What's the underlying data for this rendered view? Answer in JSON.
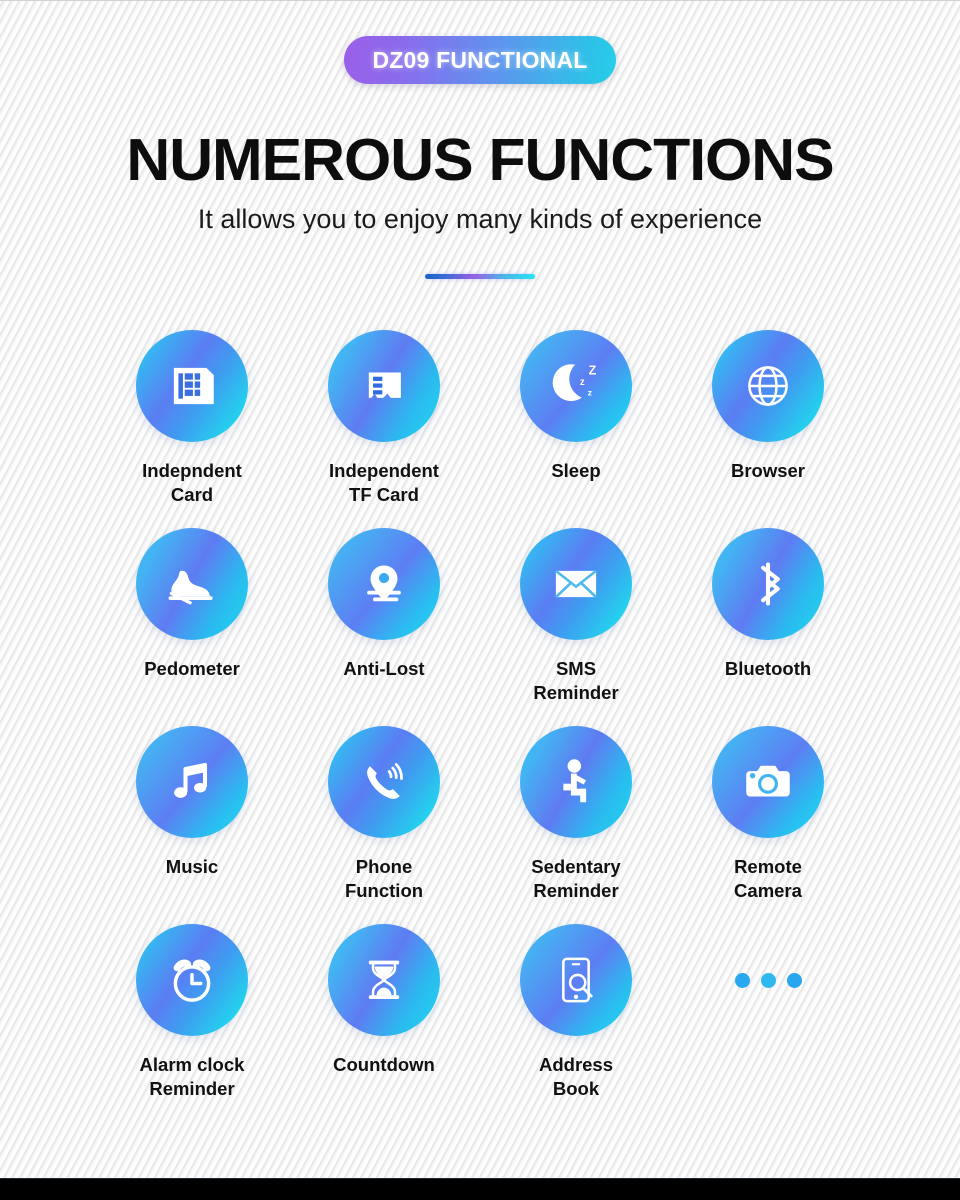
{
  "badge": {
    "label": "DZ09 FUNCTIONAL"
  },
  "header": {
    "title": "NUMEROUS FUNCTIONS",
    "subtitle": "It allows you to enjoy many kinds of experience"
  },
  "colors": {
    "badge_start": "#9b5fe8",
    "badge_end": "#26cfe9",
    "circle_start": "#4cc9f0",
    "circle_mid": "#5b7df3",
    "circle_end": "#1fdcf0",
    "dot": "#2aa8ef",
    "title": "#0d0d0d",
    "background": "#eeeeef",
    "bottom_bar": "#000000"
  },
  "features": [
    {
      "icon": "sim-card-icon",
      "label": "Indepndent\nCard"
    },
    {
      "icon": "tf-card-icon",
      "label": "Independent\nTF Card"
    },
    {
      "icon": "moon-sleep-icon",
      "label": "Sleep"
    },
    {
      "icon": "globe-icon",
      "label": "Browser"
    },
    {
      "icon": "sneaker-icon",
      "label": "Pedometer"
    },
    {
      "icon": "location-pin-icon",
      "label": "Anti-Lost"
    },
    {
      "icon": "envelope-icon",
      "label": "SMS\nReminder"
    },
    {
      "icon": "bluetooth-icon",
      "label": "Bluetooth"
    },
    {
      "icon": "music-note-icon",
      "label": "Music"
    },
    {
      "icon": "phone-ringing-icon",
      "label": "Phone\nFunction"
    },
    {
      "icon": "sitting-person-icon",
      "label": "Sedentary\nReminder"
    },
    {
      "icon": "camera-icon",
      "label": "Remote\nCamera"
    },
    {
      "icon": "alarm-clock-icon",
      "label": "Alarm clock\nReminder"
    },
    {
      "icon": "hourglass-icon",
      "label": "Countdown"
    },
    {
      "icon": "phone-search-icon",
      "label": "Address\nBook"
    },
    {
      "icon": "three-dots-icon",
      "label": ""
    }
  ]
}
